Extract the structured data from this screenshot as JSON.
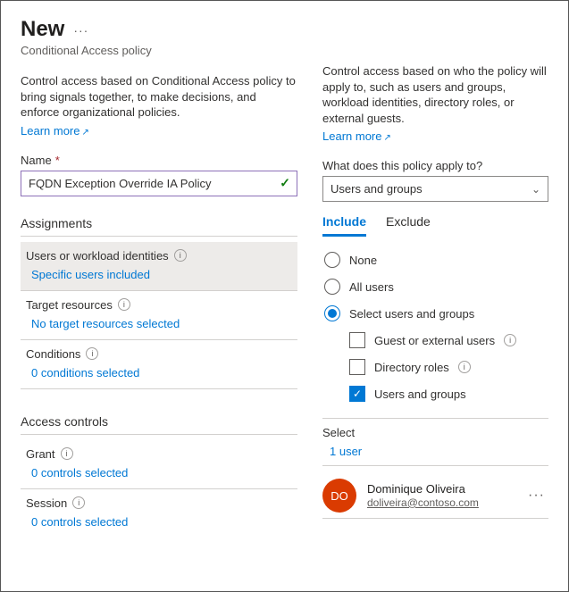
{
  "header": {
    "title": "New",
    "subtitle": "Conditional Access policy",
    "menu_label": "···"
  },
  "left": {
    "description": "Control access based on Conditional Access policy to bring signals together, to make decisions, and enforce organizational policies.",
    "learn_more": "Learn more",
    "name_label": "Name",
    "name_value": "FQDN Exception Override IA Policy",
    "assignments_h": "Assignments",
    "uwi_label": "Users or workload identities",
    "uwi_value": "Specific users included",
    "target_label": "Target resources",
    "target_value": "No target resources selected",
    "cond_label": "Conditions",
    "cond_value": "0 conditions selected",
    "access_h": "Access controls",
    "grant_label": "Grant",
    "grant_value": "0 controls selected",
    "session_label": "Session",
    "session_value": "0 controls selected"
  },
  "right": {
    "description": "Control access based on who the policy will apply to, such as users and groups, workload identities, directory roles, or external guests.",
    "learn_more": "Learn more",
    "apply_label": "What does this policy apply to?",
    "apply_value": "Users and groups",
    "tab_include": "Include",
    "tab_exclude": "Exclude",
    "opt_none": "None",
    "opt_all": "All users",
    "opt_select": "Select users and groups",
    "chk_guest": "Guest or external users",
    "chk_roles": "Directory roles",
    "chk_groups": "Users and groups",
    "select_h": "Select",
    "select_count": "1 user",
    "user": {
      "initials": "DO",
      "name": "Dominique Oliveira",
      "email": "doliveira@contoso.com"
    }
  }
}
